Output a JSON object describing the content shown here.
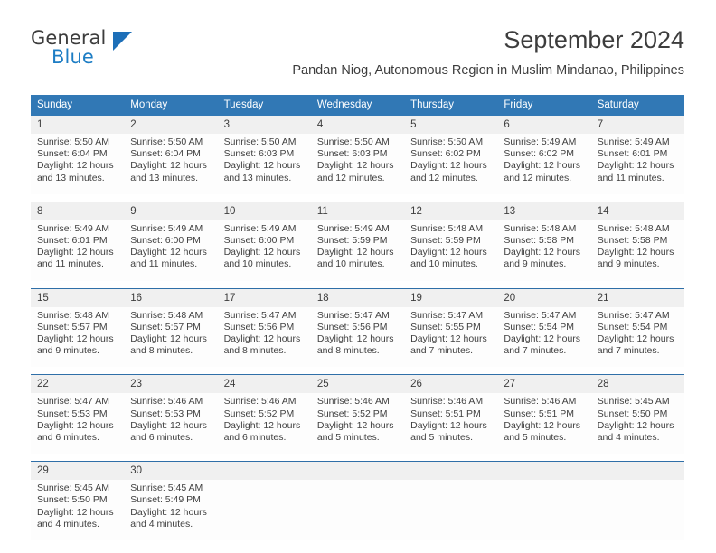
{
  "brand": {
    "name_part1": "General",
    "name_part2": "Blue",
    "triangle_color": "#1d6fb8",
    "blue_text_color": "#1d7dc4"
  },
  "header": {
    "month_title": "September 2024",
    "location": "Pandan Niog, Autonomous Region in Muslim Mindanao, Philippines"
  },
  "colors": {
    "header_band": "#3178b5",
    "daynum_band": "#f0f0f0",
    "cell_background": "#fdfdfd",
    "row_divider": "#2f6fa8"
  },
  "weekdays": [
    "Sunday",
    "Monday",
    "Tuesday",
    "Wednesday",
    "Thursday",
    "Friday",
    "Saturday"
  ],
  "weeks": [
    {
      "days": [
        {
          "num": "1",
          "sunrise": "Sunrise: 5:50 AM",
          "sunset": "Sunset: 6:04 PM",
          "daylight1": "Daylight: 12 hours",
          "daylight2": "and 13 minutes."
        },
        {
          "num": "2",
          "sunrise": "Sunrise: 5:50 AM",
          "sunset": "Sunset: 6:04 PM",
          "daylight1": "Daylight: 12 hours",
          "daylight2": "and 13 minutes."
        },
        {
          "num": "3",
          "sunrise": "Sunrise: 5:50 AM",
          "sunset": "Sunset: 6:03 PM",
          "daylight1": "Daylight: 12 hours",
          "daylight2": "and 13 minutes."
        },
        {
          "num": "4",
          "sunrise": "Sunrise: 5:50 AM",
          "sunset": "Sunset: 6:03 PM",
          "daylight1": "Daylight: 12 hours",
          "daylight2": "and 12 minutes."
        },
        {
          "num": "5",
          "sunrise": "Sunrise: 5:50 AM",
          "sunset": "Sunset: 6:02 PM",
          "daylight1": "Daylight: 12 hours",
          "daylight2": "and 12 minutes."
        },
        {
          "num": "6",
          "sunrise": "Sunrise: 5:49 AM",
          "sunset": "Sunset: 6:02 PM",
          "daylight1": "Daylight: 12 hours",
          "daylight2": "and 12 minutes."
        },
        {
          "num": "7",
          "sunrise": "Sunrise: 5:49 AM",
          "sunset": "Sunset: 6:01 PM",
          "daylight1": "Daylight: 12 hours",
          "daylight2": "and 11 minutes."
        }
      ]
    },
    {
      "days": [
        {
          "num": "8",
          "sunrise": "Sunrise: 5:49 AM",
          "sunset": "Sunset: 6:01 PM",
          "daylight1": "Daylight: 12 hours",
          "daylight2": "and 11 minutes."
        },
        {
          "num": "9",
          "sunrise": "Sunrise: 5:49 AM",
          "sunset": "Sunset: 6:00 PM",
          "daylight1": "Daylight: 12 hours",
          "daylight2": "and 11 minutes."
        },
        {
          "num": "10",
          "sunrise": "Sunrise: 5:49 AM",
          "sunset": "Sunset: 6:00 PM",
          "daylight1": "Daylight: 12 hours",
          "daylight2": "and 10 minutes."
        },
        {
          "num": "11",
          "sunrise": "Sunrise: 5:49 AM",
          "sunset": "Sunset: 5:59 PM",
          "daylight1": "Daylight: 12 hours",
          "daylight2": "and 10 minutes."
        },
        {
          "num": "12",
          "sunrise": "Sunrise: 5:48 AM",
          "sunset": "Sunset: 5:59 PM",
          "daylight1": "Daylight: 12 hours",
          "daylight2": "and 10 minutes."
        },
        {
          "num": "13",
          "sunrise": "Sunrise: 5:48 AM",
          "sunset": "Sunset: 5:58 PM",
          "daylight1": "Daylight: 12 hours",
          "daylight2": "and 9 minutes."
        },
        {
          "num": "14",
          "sunrise": "Sunrise: 5:48 AM",
          "sunset": "Sunset: 5:58 PM",
          "daylight1": "Daylight: 12 hours",
          "daylight2": "and 9 minutes."
        }
      ]
    },
    {
      "days": [
        {
          "num": "15",
          "sunrise": "Sunrise: 5:48 AM",
          "sunset": "Sunset: 5:57 PM",
          "daylight1": "Daylight: 12 hours",
          "daylight2": "and 9 minutes."
        },
        {
          "num": "16",
          "sunrise": "Sunrise: 5:48 AM",
          "sunset": "Sunset: 5:57 PM",
          "daylight1": "Daylight: 12 hours",
          "daylight2": "and 8 minutes."
        },
        {
          "num": "17",
          "sunrise": "Sunrise: 5:47 AM",
          "sunset": "Sunset: 5:56 PM",
          "daylight1": "Daylight: 12 hours",
          "daylight2": "and 8 minutes."
        },
        {
          "num": "18",
          "sunrise": "Sunrise: 5:47 AM",
          "sunset": "Sunset: 5:56 PM",
          "daylight1": "Daylight: 12 hours",
          "daylight2": "and 8 minutes."
        },
        {
          "num": "19",
          "sunrise": "Sunrise: 5:47 AM",
          "sunset": "Sunset: 5:55 PM",
          "daylight1": "Daylight: 12 hours",
          "daylight2": "and 7 minutes."
        },
        {
          "num": "20",
          "sunrise": "Sunrise: 5:47 AM",
          "sunset": "Sunset: 5:54 PM",
          "daylight1": "Daylight: 12 hours",
          "daylight2": "and 7 minutes."
        },
        {
          "num": "21",
          "sunrise": "Sunrise: 5:47 AM",
          "sunset": "Sunset: 5:54 PM",
          "daylight1": "Daylight: 12 hours",
          "daylight2": "and 7 minutes."
        }
      ]
    },
    {
      "days": [
        {
          "num": "22",
          "sunrise": "Sunrise: 5:47 AM",
          "sunset": "Sunset: 5:53 PM",
          "daylight1": "Daylight: 12 hours",
          "daylight2": "and 6 minutes."
        },
        {
          "num": "23",
          "sunrise": "Sunrise: 5:46 AM",
          "sunset": "Sunset: 5:53 PM",
          "daylight1": "Daylight: 12 hours",
          "daylight2": "and 6 minutes."
        },
        {
          "num": "24",
          "sunrise": "Sunrise: 5:46 AM",
          "sunset": "Sunset: 5:52 PM",
          "daylight1": "Daylight: 12 hours",
          "daylight2": "and 6 minutes."
        },
        {
          "num": "25",
          "sunrise": "Sunrise: 5:46 AM",
          "sunset": "Sunset: 5:52 PM",
          "daylight1": "Daylight: 12 hours",
          "daylight2": "and 5 minutes."
        },
        {
          "num": "26",
          "sunrise": "Sunrise: 5:46 AM",
          "sunset": "Sunset: 5:51 PM",
          "daylight1": "Daylight: 12 hours",
          "daylight2": "and 5 minutes."
        },
        {
          "num": "27",
          "sunrise": "Sunrise: 5:46 AM",
          "sunset": "Sunset: 5:51 PM",
          "daylight1": "Daylight: 12 hours",
          "daylight2": "and 5 minutes."
        },
        {
          "num": "28",
          "sunrise": "Sunrise: 5:45 AM",
          "sunset": "Sunset: 5:50 PM",
          "daylight1": "Daylight: 12 hours",
          "daylight2": "and 4 minutes."
        }
      ]
    },
    {
      "days": [
        {
          "num": "29",
          "sunrise": "Sunrise: 5:45 AM",
          "sunset": "Sunset: 5:50 PM",
          "daylight1": "Daylight: 12 hours",
          "daylight2": "and 4 minutes."
        },
        {
          "num": "30",
          "sunrise": "Sunrise: 5:45 AM",
          "sunset": "Sunset: 5:49 PM",
          "daylight1": "Daylight: 12 hours",
          "daylight2": "and 4 minutes."
        },
        {
          "num": "",
          "sunrise": "",
          "sunset": "",
          "daylight1": "",
          "daylight2": ""
        },
        {
          "num": "",
          "sunrise": "",
          "sunset": "",
          "daylight1": "",
          "daylight2": ""
        },
        {
          "num": "",
          "sunrise": "",
          "sunset": "",
          "daylight1": "",
          "daylight2": ""
        },
        {
          "num": "",
          "sunrise": "",
          "sunset": "",
          "daylight1": "",
          "daylight2": ""
        },
        {
          "num": "",
          "sunrise": "",
          "sunset": "",
          "daylight1": "",
          "daylight2": ""
        }
      ]
    }
  ]
}
